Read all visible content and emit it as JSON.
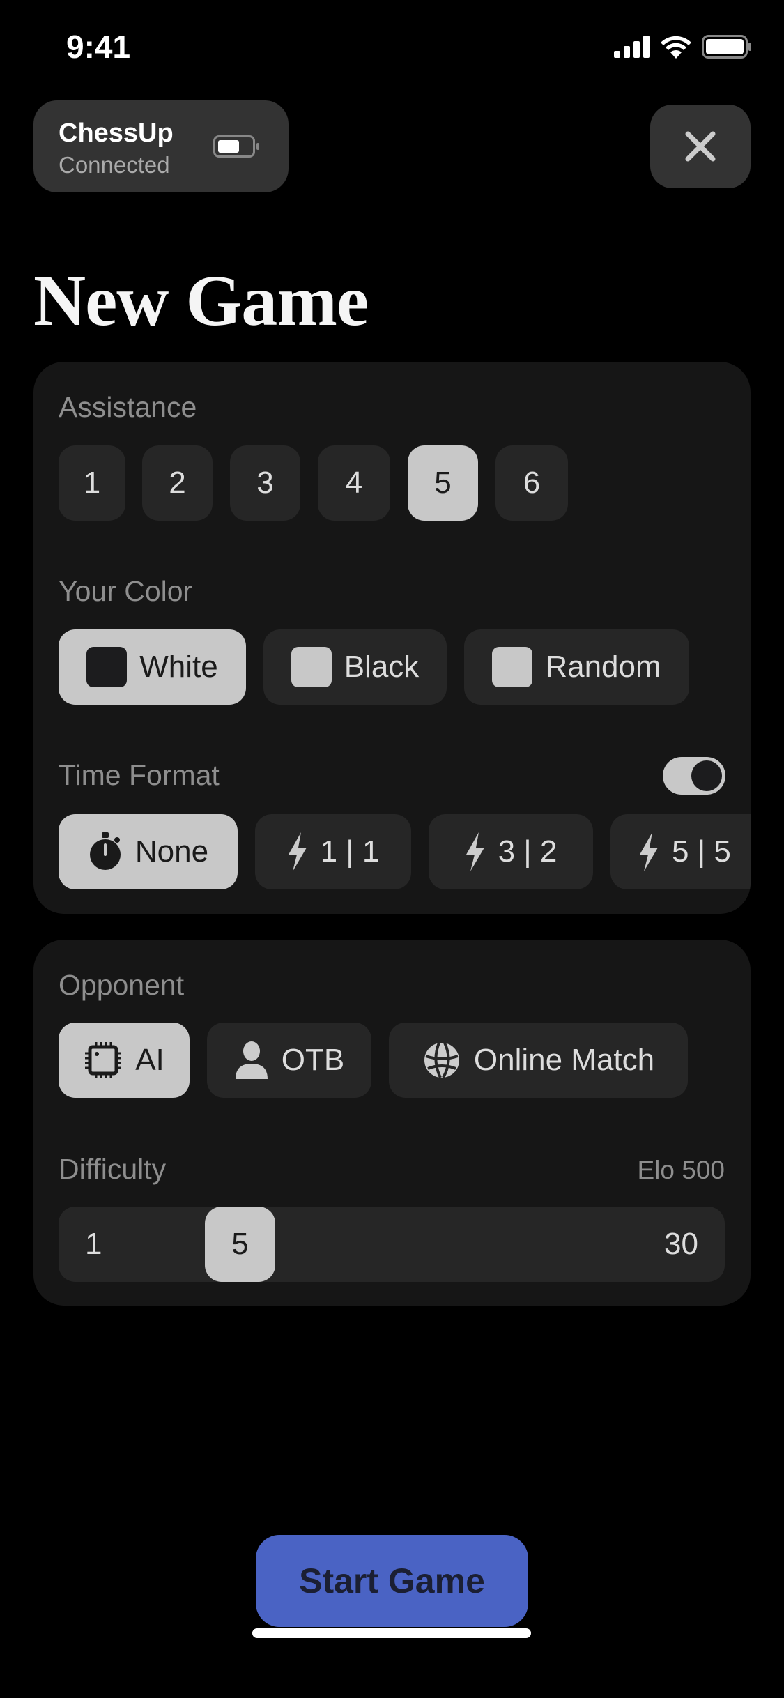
{
  "status_bar": {
    "time": "9:41"
  },
  "device": {
    "name": "ChessUp",
    "status": "Connected"
  },
  "page_title": "New Game",
  "assistance": {
    "label": "Assistance",
    "options": [
      "1",
      "2",
      "3",
      "4",
      "5",
      "6"
    ],
    "selected": "5"
  },
  "color": {
    "label": "Your Color",
    "options": [
      "White",
      "Black",
      "Random"
    ],
    "selected": "White"
  },
  "time_format": {
    "label": "Time Format",
    "toggle_on": true,
    "options": [
      "None",
      "1 | 1",
      "3 | 2",
      "5 | 5"
    ],
    "selected": "None"
  },
  "opponent": {
    "label": "Opponent",
    "options": [
      "AI",
      "OTB",
      "Online Match"
    ],
    "selected": "AI"
  },
  "difficulty": {
    "label": "Difficulty",
    "elo": "Elo 500",
    "min": "1",
    "max": "30",
    "value": "5"
  },
  "start_button": "Start Game",
  "colors": {
    "accent": "#4a63c4",
    "selected": "#c8c8c8",
    "button": "#262626",
    "card": "#161616"
  }
}
